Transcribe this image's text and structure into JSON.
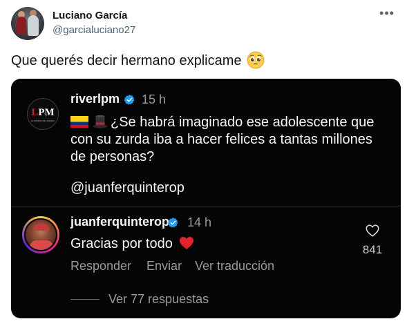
{
  "tweet": {
    "author_name": "Luciano García",
    "author_handle": "@garcialuciano27",
    "text": "Que querés decir hermano explicame",
    "more_icon": "ellipsis-icon"
  },
  "embedded_post": {
    "account": "riverlpm",
    "time": "15 h",
    "caption": "¿Se habrá imaginado ese adolescente que con su zurda iba a hacer felices a tantas millones de personas?",
    "mention": "@juanferquinterop",
    "avatar_text": "LPM",
    "avatar_subtext": "LA PÁGINA MILLONARIA"
  },
  "comment": {
    "account": "juanferquinterop",
    "time": "14 h",
    "text": "Gracias por todo",
    "likes": "841",
    "actions": {
      "reply": "Responder",
      "send": "Enviar",
      "translate": "Ver traducción"
    },
    "view_replies": "Ver 77 respuestas"
  },
  "colors": {
    "verified": "#1d9bf0",
    "media_bg": "#050505",
    "heart": "#e0242b"
  }
}
